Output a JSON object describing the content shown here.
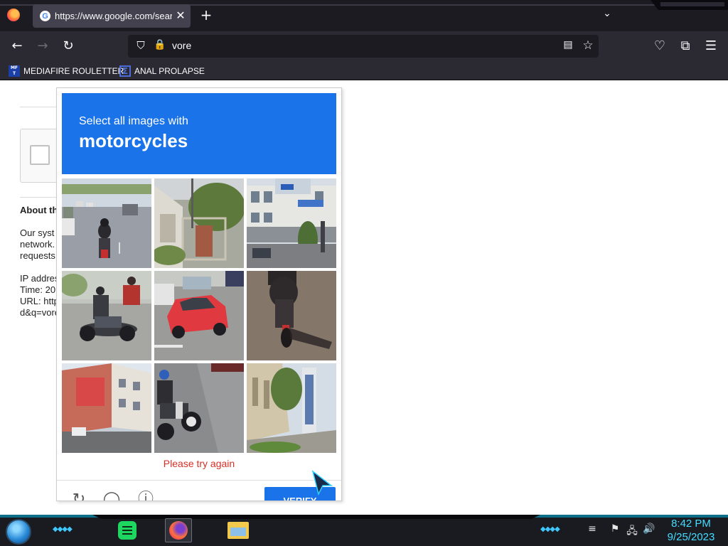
{
  "browser": {
    "tab": {
      "title": "https://www.google.com/search?",
      "favicon": "google-g-icon",
      "close": "✕"
    },
    "new_tab": "+",
    "tab_list": "⌄",
    "nav": {
      "back": "←",
      "forward": "→",
      "reload": "↻"
    },
    "urlbar": {
      "text": "vore",
      "shield": "⛉",
      "lock": "🔒",
      "reader": "▤",
      "star": "☆"
    },
    "toolbar_right": {
      "pocket": "♡",
      "extensions": "⧉",
      "menu": "☰"
    },
    "bookmarks": [
      {
        "label": "MEDIAFIRE ROULETTER",
        "icon_text": "MF T"
      },
      {
        "label": "ANAL PROLAPSE",
        "icon_text": "Σ"
      }
    ]
  },
  "page": {
    "about_title": "About th",
    "about_lines": [
      "Our syst",
      "network.",
      "requests",
      "",
      "IP addres",
      "Time: 20",
      "URL: http",
      "d&q=vore"
    ]
  },
  "captcha": {
    "instruction": "Select all images with",
    "target": "motorcycles",
    "error": "Please try again",
    "verify_label": "VERIFY",
    "controls": {
      "reload": "↻",
      "audio": "◯",
      "info": "ⓘ"
    },
    "tiles": [
      {
        "name": "road-motorcycle"
      },
      {
        "name": "house-wall"
      },
      {
        "name": "shophouses"
      },
      {
        "name": "riders-motorcycle"
      },
      {
        "name": "red-car"
      },
      {
        "name": "motorcycle-topdown"
      },
      {
        "name": "building-corner"
      },
      {
        "name": "motorcycle-street"
      },
      {
        "name": "sidewalk-sign"
      }
    ]
  },
  "taskbar": {
    "clock_time": "8:42 PM",
    "clock_date": "9/25/2023",
    "apps": [
      "notes-app-icon",
      "firefox-icon",
      "file-explorer-icon"
    ],
    "tray": {
      "flag": "⚑",
      "network": "🖧",
      "volume": "🔊",
      "menu": "≡"
    }
  },
  "colors": {
    "accent": "#1a73e8",
    "error": "#d93025",
    "chrome_dark": "#1c1b22",
    "chrome": "#2b2a33",
    "clock": "#44ddff"
  }
}
